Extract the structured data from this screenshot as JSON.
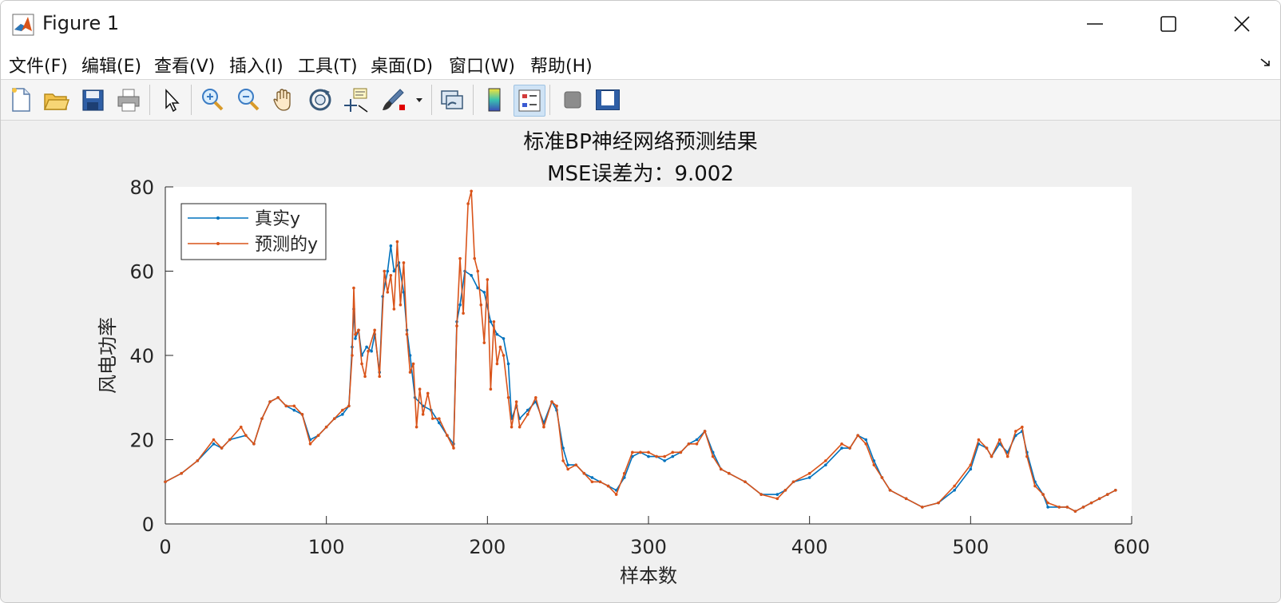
{
  "window": {
    "title": "Figure 1",
    "icon": "matlab-logo-icon"
  },
  "menu": [
    {
      "label": "文件(F)"
    },
    {
      "label": "编辑(E)"
    },
    {
      "label": "查看(V)"
    },
    {
      "label": "插入(I)"
    },
    {
      "label": "工具(T)"
    },
    {
      "label": "桌面(D)"
    },
    {
      "label": "窗口(W)"
    },
    {
      "label": "帮助(H)"
    }
  ],
  "toolbar": [
    "new-figure-icon",
    "open-file-icon",
    "save-icon",
    "print-icon",
    "select-arrow-icon",
    "zoom-in-icon",
    "zoom-out-icon",
    "pan-hand-icon",
    "rotate-3d-icon",
    "data-cursor-icon",
    "brush-icon",
    "link-plot-icon",
    "colorbar-icon",
    "legend-icon",
    "hide-plot-tools-icon",
    "show-plot-tools-icon"
  ],
  "chart_data": {
    "type": "line",
    "title": "标准BP神经网络预测结果",
    "subtitle": "MSE误差为：9.002",
    "xlabel": "样本数",
    "ylabel": "风电功率",
    "xlim": [
      0,
      600
    ],
    "ylim": [
      0,
      80
    ],
    "xticks": [
      0,
      100,
      200,
      300,
      400,
      500,
      600
    ],
    "yticks": [
      0,
      20,
      40,
      60,
      80
    ],
    "grid": false,
    "legend_position": "top-left",
    "series": [
      {
        "name": "真实y",
        "color": "#0072BD",
        "marker": "dot",
        "points": [
          [
            0,
            10
          ],
          [
            10,
            12
          ],
          [
            20,
            15
          ],
          [
            30,
            19
          ],
          [
            35,
            18
          ],
          [
            40,
            20
          ],
          [
            50,
            21
          ],
          [
            55,
            19
          ],
          [
            60,
            25
          ],
          [
            65,
            29
          ],
          [
            70,
            30
          ],
          [
            75,
            28
          ],
          [
            80,
            27
          ],
          [
            85,
            26
          ],
          [
            90,
            20
          ],
          [
            95,
            21
          ],
          [
            100,
            23
          ],
          [
            105,
            25
          ],
          [
            110,
            26
          ],
          [
            114,
            28
          ],
          [
            116,
            42
          ],
          [
            117,
            51
          ],
          [
            118,
            44
          ],
          [
            120,
            46
          ],
          [
            122,
            40
          ],
          [
            125,
            42
          ],
          [
            128,
            41
          ],
          [
            130,
            45
          ],
          [
            133,
            36
          ],
          [
            135,
            54
          ],
          [
            138,
            60
          ],
          [
            140,
            66
          ],
          [
            142,
            60
          ],
          [
            145,
            62
          ],
          [
            148,
            55
          ],
          [
            150,
            46
          ],
          [
            152,
            40
          ],
          [
            155,
            30
          ],
          [
            160,
            28
          ],
          [
            165,
            27
          ],
          [
            170,
            24
          ],
          [
            175,
            21
          ],
          [
            179,
            19
          ],
          [
            181,
            48
          ],
          [
            183,
            52
          ],
          [
            186,
            60
          ],
          [
            190,
            59
          ],
          [
            194,
            56
          ],
          [
            198,
            55
          ],
          [
            202,
            48
          ],
          [
            206,
            45
          ],
          [
            210,
            44
          ],
          [
            213,
            38
          ],
          [
            215,
            25
          ],
          [
            218,
            28
          ],
          [
            220,
            25
          ],
          [
            225,
            27
          ],
          [
            230,
            29
          ],
          [
            235,
            24
          ],
          [
            240,
            29
          ],
          [
            243,
            27
          ],
          [
            247,
            18
          ],
          [
            250,
            14
          ],
          [
            255,
            14
          ],
          [
            260,
            12
          ],
          [
            265,
            11
          ],
          [
            270,
            10
          ],
          [
            275,
            9
          ],
          [
            280,
            8
          ],
          [
            285,
            11
          ],
          [
            290,
            16
          ],
          [
            295,
            17
          ],
          [
            300,
            16
          ],
          [
            305,
            16
          ],
          [
            310,
            15
          ],
          [
            315,
            16
          ],
          [
            320,
            17
          ],
          [
            325,
            19
          ],
          [
            330,
            20
          ],
          [
            335,
            22
          ],
          [
            340,
            17
          ],
          [
            345,
            13
          ],
          [
            350,
            12
          ],
          [
            360,
            10
          ],
          [
            370,
            7
          ],
          [
            380,
            7
          ],
          [
            385,
            8
          ],
          [
            390,
            10
          ],
          [
            400,
            11
          ],
          [
            410,
            14
          ],
          [
            420,
            18
          ],
          [
            425,
            18
          ],
          [
            430,
            21
          ],
          [
            435,
            20
          ],
          [
            440,
            15
          ],
          [
            445,
            11
          ],
          [
            450,
            8
          ],
          [
            460,
            6
          ],
          [
            470,
            4
          ],
          [
            480,
            5
          ],
          [
            490,
            8
          ],
          [
            500,
            13
          ],
          [
            505,
            19
          ],
          [
            510,
            18
          ],
          [
            513,
            16
          ],
          [
            518,
            19
          ],
          [
            523,
            17
          ],
          [
            528,
            21
          ],
          [
            532,
            22
          ],
          [
            535,
            17
          ],
          [
            540,
            10
          ],
          [
            545,
            7
          ],
          [
            548,
            4
          ],
          [
            555,
            4
          ],
          [
            560,
            4
          ],
          [
            565,
            3
          ],
          [
            570,
            4
          ],
          [
            575,
            5
          ],
          [
            580,
            6
          ],
          [
            585,
            7
          ],
          [
            590,
            8
          ]
        ]
      },
      {
        "name": "预测的y",
        "color": "#D95319",
        "marker": "dot",
        "points": [
          [
            0,
            10
          ],
          [
            10,
            12
          ],
          [
            20,
            15
          ],
          [
            30,
            20
          ],
          [
            35,
            18
          ],
          [
            40,
            20
          ],
          [
            47,
            23
          ],
          [
            50,
            21
          ],
          [
            55,
            19
          ],
          [
            60,
            25
          ],
          [
            65,
            29
          ],
          [
            70,
            30
          ],
          [
            75,
            28
          ],
          [
            80,
            28
          ],
          [
            85,
            26
          ],
          [
            90,
            19
          ],
          [
            95,
            21
          ],
          [
            100,
            23
          ],
          [
            105,
            25
          ],
          [
            110,
            27
          ],
          [
            114,
            28
          ],
          [
            116,
            40
          ],
          [
            117,
            56
          ],
          [
            118,
            45
          ],
          [
            120,
            46
          ],
          [
            122,
            38
          ],
          [
            124,
            35
          ],
          [
            126,
            41
          ],
          [
            130,
            46
          ],
          [
            133,
            35
          ],
          [
            136,
            60
          ],
          [
            138,
            55
          ],
          [
            140,
            59
          ],
          [
            142,
            51
          ],
          [
            144,
            67
          ],
          [
            146,
            52
          ],
          [
            148,
            62
          ],
          [
            150,
            45
          ],
          [
            152,
            36
          ],
          [
            154,
            38
          ],
          [
            156,
            23
          ],
          [
            158,
            32
          ],
          [
            160,
            26
          ],
          [
            163,
            31
          ],
          [
            166,
            25
          ],
          [
            170,
            25
          ],
          [
            175,
            21
          ],
          [
            179,
            18
          ],
          [
            181,
            47
          ],
          [
            183,
            63
          ],
          [
            185,
            50
          ],
          [
            188,
            76
          ],
          [
            190,
            79
          ],
          [
            192,
            63
          ],
          [
            194,
            60
          ],
          [
            196,
            52
          ],
          [
            198,
            43
          ],
          [
            200,
            58
          ],
          [
            202,
            32
          ],
          [
            204,
            48
          ],
          [
            206,
            38
          ],
          [
            208,
            42
          ],
          [
            210,
            40
          ],
          [
            213,
            30
          ],
          [
            215,
            23
          ],
          [
            218,
            29
          ],
          [
            220,
            23
          ],
          [
            225,
            26
          ],
          [
            230,
            30
          ],
          [
            235,
            23
          ],
          [
            240,
            29
          ],
          [
            243,
            28
          ],
          [
            247,
            15
          ],
          [
            250,
            13
          ],
          [
            255,
            14
          ],
          [
            260,
            12
          ],
          [
            265,
            10
          ],
          [
            270,
            10
          ],
          [
            275,
            9
          ],
          [
            280,
            7
          ],
          [
            285,
            12
          ],
          [
            290,
            17
          ],
          [
            295,
            17
          ],
          [
            300,
            17
          ],
          [
            305,
            16
          ],
          [
            310,
            16
          ],
          [
            315,
            17
          ],
          [
            320,
            17
          ],
          [
            325,
            19
          ],
          [
            330,
            19
          ],
          [
            335,
            22
          ],
          [
            340,
            16
          ],
          [
            345,
            13
          ],
          [
            350,
            12
          ],
          [
            360,
            10
          ],
          [
            370,
            7
          ],
          [
            380,
            6
          ],
          [
            385,
            8
          ],
          [
            390,
            10
          ],
          [
            400,
            12
          ],
          [
            410,
            15
          ],
          [
            420,
            19
          ],
          [
            425,
            18
          ],
          [
            430,
            21
          ],
          [
            435,
            19
          ],
          [
            440,
            14
          ],
          [
            445,
            11
          ],
          [
            450,
            8
          ],
          [
            460,
            6
          ],
          [
            470,
            4
          ],
          [
            480,
            5
          ],
          [
            490,
            9
          ],
          [
            500,
            14
          ],
          [
            505,
            20
          ],
          [
            510,
            18
          ],
          [
            513,
            16
          ],
          [
            518,
            20
          ],
          [
            523,
            16
          ],
          [
            528,
            22
          ],
          [
            532,
            23
          ],
          [
            535,
            16
          ],
          [
            540,
            9
          ],
          [
            545,
            7
          ],
          [
            548,
            5
          ],
          [
            555,
            4
          ],
          [
            560,
            4
          ],
          [
            565,
            3
          ],
          [
            570,
            4
          ],
          [
            575,
            5
          ],
          [
            580,
            6
          ],
          [
            585,
            7
          ],
          [
            590,
            8
          ]
        ]
      }
    ]
  }
}
